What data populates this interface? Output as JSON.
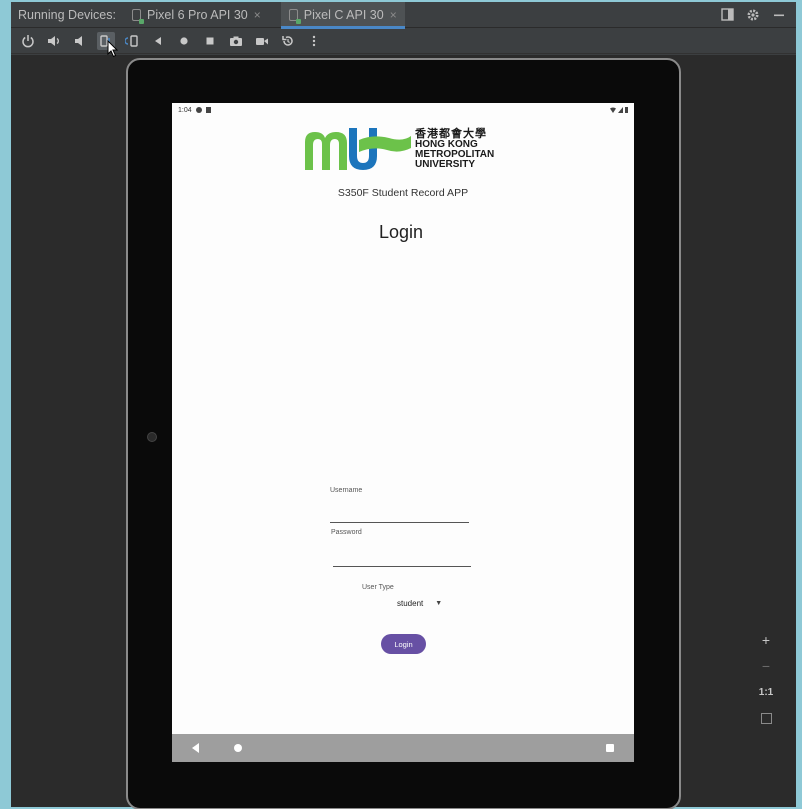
{
  "ide": {
    "running_devices_label": "Running Devices:",
    "tabs": [
      {
        "label": "Pixel 6 Pro API 30",
        "active": false
      },
      {
        "label": "Pixel C API 30",
        "active": true
      }
    ],
    "close_glyph": "×"
  },
  "toolbar": {
    "icons": [
      "power-icon",
      "volume-up-icon",
      "volume-down-icon",
      "rotate-left-icon",
      "rotate-right-icon",
      "back-icon",
      "home-icon",
      "overview-icon",
      "screenshot-icon",
      "screen-record-icon",
      "reset-icon",
      "more-icon"
    ]
  },
  "zoom": {
    "plus": "+",
    "minus": "−",
    "one_to_one": "1:1"
  },
  "device": {
    "status_time": "1:04",
    "app_subtitle": "S350F Student Record APP",
    "screen_title": "Login",
    "logo": {
      "chinese": "香港都會大學",
      "line1": "HONG KONG",
      "line2": "METROPOLITAN",
      "line3": "UNIVERSITY",
      "green": "#6cc24a",
      "blue": "#1c75bc"
    },
    "username_label": "Username",
    "password_label": "Password",
    "user_type_label": "User Type",
    "user_type_value": "student",
    "login_button": "Login",
    "accent": "#6750a4"
  }
}
